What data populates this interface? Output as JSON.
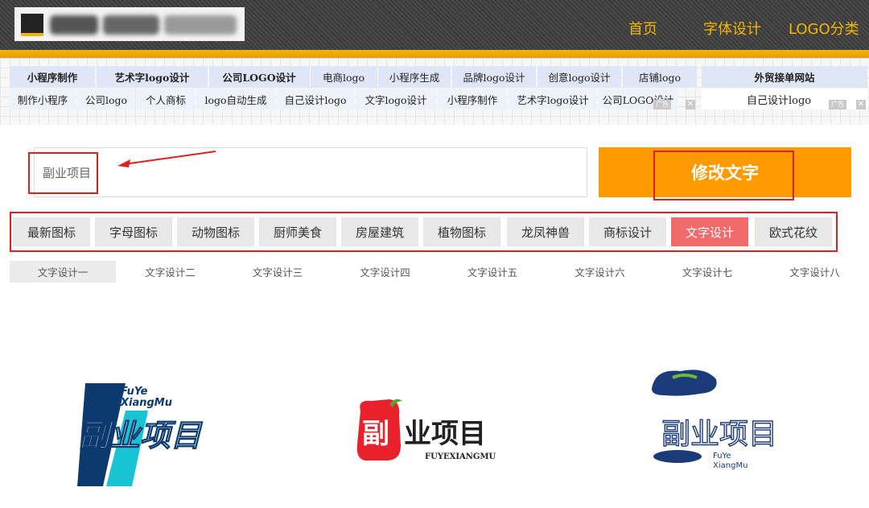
{
  "header": {
    "nav": [
      "首页",
      "字体设计",
      "LOGO分类"
    ]
  },
  "ad_links": {
    "row1": [
      {
        "label": "小程序制作",
        "bold": true
      },
      {
        "label": "艺术字logo设计",
        "bold": true
      },
      {
        "label": "公司LOGO设计",
        "bold": true
      },
      {
        "label": "电商logo",
        "bold": false
      },
      {
        "label": "小程序生成",
        "bold": false
      },
      {
        "label": "品牌logo设计",
        "bold": false
      },
      {
        "label": "创意logo设计",
        "bold": false
      },
      {
        "label": "店铺logo",
        "bold": false
      }
    ],
    "row2": [
      "制作小程序",
      "公司logo",
      "个人商标",
      "logo自动生成",
      "自己设计logo",
      "文字logo设计",
      "小程序制作",
      "艺术字logo设计",
      "公司LOGO设计"
    ],
    "side_top": "外贸接单网站",
    "side_bottom": "自己设计logo",
    "ad_tag": "广告",
    "close_glyph": "✕"
  },
  "editor": {
    "input_value": "副业项目",
    "modify_label": "修改文字"
  },
  "categories": {
    "items": [
      "最新图标",
      "字母图标",
      "动物图标",
      "厨师美食",
      "房屋建筑",
      "植物图标",
      "龙凤神兽",
      "商标设计",
      "文字设计",
      "欧式花纹"
    ],
    "active_index": 8
  },
  "sub_tabs": {
    "items": [
      "文字设计一",
      "文字设计二",
      "文字设计三",
      "文字设计四",
      "文字设计五",
      "文字设计六",
      "文字设计七",
      "文字设计八"
    ],
    "active_index": 0
  },
  "samples": {
    "sample1": {
      "line1": "FuYe",
      "line2": "XiangMu",
      "title": "副业项目"
    },
    "sample2": {
      "title_left": "副",
      "title_right": "业项目",
      "subtitle": "FUYEXIANGMU"
    },
    "sample3": {
      "title": "副业项目",
      "line1": "FuYe",
      "line2": "XiangMu"
    }
  },
  "colors": {
    "accent_orange": "#ff9a00",
    "nav_gold": "#f2b600",
    "highlight_red": "#e02020",
    "active_category": "#f26a6a",
    "sample1_blue": "#0d3a6e",
    "sample1_cyan": "#18c3d4",
    "sample2_red": "#e8212a",
    "sample3_navy": "#1b3a7a"
  }
}
